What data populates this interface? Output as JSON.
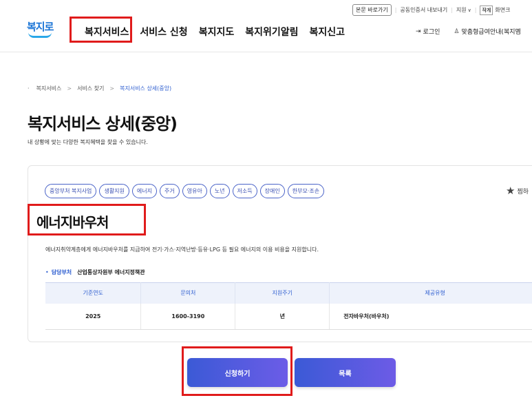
{
  "utility": {
    "skip_link": "본문 바로가기",
    "cert_export": "공동인증서 내보내기",
    "support": "지원",
    "small_btn": "작게",
    "screen": "화면크"
  },
  "logo": {
    "text": "복지로"
  },
  "gnb": [
    "복지서비스",
    "서비스 신청",
    "복지지도",
    "복지위기알림",
    "복지신고"
  ],
  "header_right": {
    "login": "로그인",
    "custom_guide": "맞춤형급여안내(복지멤"
  },
  "breadcrumb": [
    "복지서비스",
    "서비스 찾기",
    "복지서비스 상세(중앙)"
  ],
  "page": {
    "title": "복지서비스 상세(중앙)",
    "description": "내 상황에 맞는 다양한 복지혜택을 찾을 수 있습니다."
  },
  "service": {
    "tags": [
      "중앙부처 복지사업",
      "생활지원",
      "에너지",
      "주거",
      "영유아",
      "노년",
      "저소득",
      "장애인",
      "한부모·조손"
    ],
    "bookmark": "찜하",
    "title": "에너지바우처",
    "description": "에너지취약계층에게 에너지바우처를 지급하여 전기·가스·지역난방·등유·LPG 등 필요 에너지의 이용 비용을 지원합니다.",
    "dept_label": "담당부처",
    "dept_value": "산업통상자원부 에너지정책관",
    "table": {
      "headers": [
        "기준연도",
        "문의처",
        "지원주기",
        "제공유형"
      ],
      "row": [
        "2025",
        "1600-3190",
        "년",
        "전자바우처(바우처)"
      ]
    }
  },
  "buttons": {
    "apply": "신청하기",
    "list": "목록"
  },
  "colors": {
    "accent": "#2f5fd0",
    "highlight": "#e01b1b",
    "button": "#4a5ae0"
  }
}
